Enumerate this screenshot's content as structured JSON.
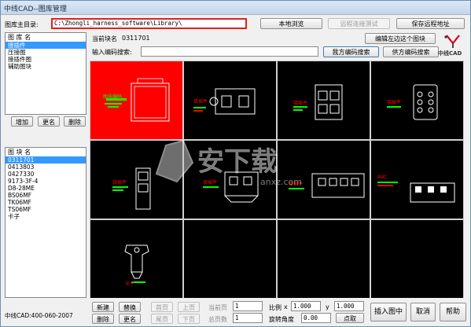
{
  "window": {
    "title": "中线CAD--图库管理"
  },
  "top": {
    "dir_label": "图库主目录:",
    "dir_value": "C:\\Zhongli_harness_software\\Library\\",
    "btn_browse": "本地浏览",
    "btn_remote": "远程连接测试",
    "btn_save_remote": "保存远程地址",
    "current_code_label": "当前块名",
    "current_code_value": "0311701",
    "btn_edit_block": "编辑左边这个图块",
    "search_label": "输入编码搜索:",
    "search_value": "",
    "btn_search_mine": "我方编码搜索",
    "btn_search_supplier": "供方编码搜索"
  },
  "library": {
    "header": "图 库 名",
    "items": [
      "接插件",
      "压接图",
      "接插件图",
      "辅助图块"
    ],
    "selected_index": 0,
    "btn_add": "增加",
    "btn_rename": "更名",
    "btn_delete": "删除"
  },
  "blocks": {
    "header": "图 块 名",
    "items": [
      "0311701",
      "0413803",
      "0427330",
      "9173-3F-4",
      "D8-28ME",
      "BS06MF",
      "TK06MF",
      "TS06MF",
      "卡子"
    ],
    "selected_index": 0
  },
  "cells": [
    {
      "kind": "highlight",
      "caption": "图块编码"
    },
    {
      "kind": "connector2",
      "caption": "接插件"
    },
    {
      "kind": "connector4",
      "caption": "接插件"
    },
    {
      "kind": "connector6",
      "caption": "接插件"
    },
    {
      "kind": "tall",
      "caption": "接插件"
    },
    {
      "kind": "wide",
      "caption": "接插件"
    },
    {
      "kind": "long",
      "caption": "接插件"
    },
    {
      "kind": "multi",
      "caption": "ABC"
    },
    {
      "kind": "clip",
      "caption": "卡子"
    },
    {
      "kind": "empty",
      "caption": ""
    },
    {
      "kind": "empty",
      "caption": ""
    },
    {
      "kind": "empty",
      "caption": ""
    }
  ],
  "bottom": {
    "footer": "中线CAD:400-060-2007",
    "btn_new": "新建",
    "btn_replace": "替换",
    "btn_delete": "删除",
    "btn_rename": "更名",
    "btn_first": "首页",
    "btn_prev": "上页",
    "btn_last": "尾页",
    "btn_next": "下页",
    "current_page_label": "当前页",
    "current_page": "1",
    "total_pages_label": "总页数",
    "total_pages": "1",
    "scale_label": "比例",
    "x_label": "x",
    "x_value": "1.000",
    "y_label": "y",
    "y_value": "1.000",
    "rotation_label": "旋转角度",
    "rotation_value": "0.00",
    "btn_pick": "点取",
    "btn_insert": "插入图中",
    "btn_cancel": "取消",
    "btn_help": "帮助"
  },
  "logo": {
    "text": "中线CAD",
    "accent": "#d0021b"
  },
  "watermark": {
    "text": "安下载",
    "sub": "anxz.com"
  },
  "colors": {
    "highlight": "#ff0000",
    "cell_bg": "#000000",
    "selection": "#3399ff",
    "label_green": "#00ff00",
    "label_red": "#ff0000"
  }
}
